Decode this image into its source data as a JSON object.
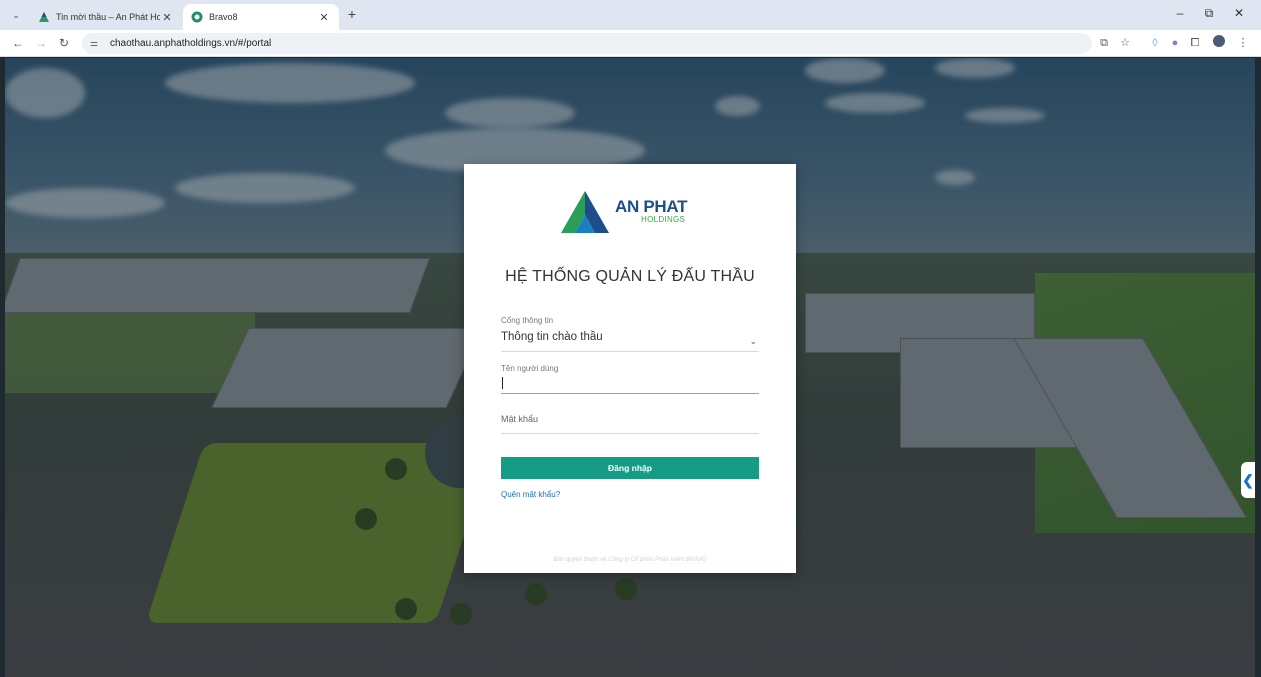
{
  "browser": {
    "tabs": [
      {
        "title": "Tin mời thầu – An Phát Holding",
        "active": false
      },
      {
        "title": "Bravo8",
        "active": true
      }
    ],
    "new_tab": "+",
    "url": "chaothau.anphatholdings.vn/#/portal",
    "window_controls": {
      "minimize": "–",
      "restore": "⧉",
      "close": "✕"
    }
  },
  "login": {
    "logo_main": "AN PHAT",
    "logo_sub": "HOLDINGS",
    "title": "HỆ THỐNG QUẢN LÝ ĐẤU THẦU",
    "portal_label": "Cổng thông tin",
    "portal_value": "Thông tin chào thầu",
    "username_label": "Tên người dùng",
    "username_value": "",
    "password_label": "Mật khẩu",
    "login_button": "Đăng nhập",
    "forgot_password": "Quên mật khẩu?",
    "copyright": "Bản quyền thuộc về Công ty Cổ phần Phần mềm BRAVO"
  },
  "side_handle": "❮",
  "colors": {
    "accent": "#169c85",
    "link": "#1a6fb8",
    "logo_blue": "#1d4d8a",
    "logo_green": "#3aa84a"
  },
  "icons": [
    "chevron-down-icon",
    "back-arrow-icon",
    "forward-arrow-icon",
    "reload-icon",
    "site-info-icon",
    "cast-icon",
    "star-icon",
    "extensions-icon",
    "profile-icon",
    "menu-icon"
  ]
}
